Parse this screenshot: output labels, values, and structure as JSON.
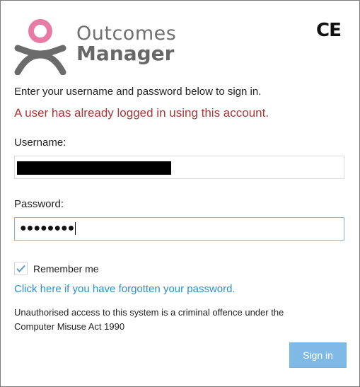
{
  "brand": {
    "line1": "Outcomes",
    "line2": "Manager",
    "certification_mark": "CE",
    "logo_ring_color": "#e77ba6",
    "logo_body_color": "#6b6b6b"
  },
  "form": {
    "intro_text": "Enter your username and password below to sign in.",
    "error_message": "A user has already logged in using this account.",
    "username_label": "Username:",
    "username_value_redacted": true,
    "password_label": "Password:",
    "password_masked": "●●●●●●●●",
    "remember_label": "Remember me",
    "remember_checked": true,
    "forgot_link": "Click here if you have forgotten your password.",
    "legal_line1": "Unauthorised access to this system is a criminal offence under the",
    "legal_line2": "Computer Misuse Act 1990",
    "signin_label": "Sign in"
  },
  "colors": {
    "error": "#a8373a",
    "link": "#2b8fcb",
    "button": "#7fbae6",
    "focus_border": "#7fb3d6"
  }
}
